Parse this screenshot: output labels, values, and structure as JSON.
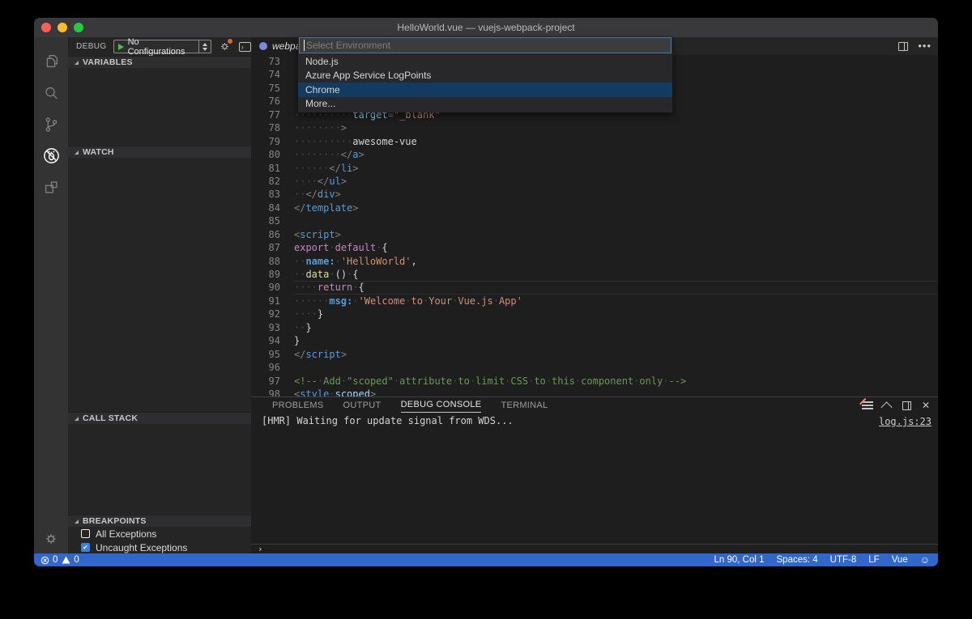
{
  "window": {
    "title": "HelloWorld.vue — vuejs-webpack-project"
  },
  "activity_bar": {
    "items": [
      {
        "icon": "explorer-icon"
      },
      {
        "icon": "search-icon"
      },
      {
        "icon": "source-control-icon"
      },
      {
        "icon": "debug-icon",
        "active": true
      },
      {
        "icon": "extensions-icon"
      }
    ],
    "settings_icon": "gear-icon"
  },
  "sidebar": {
    "toolbar": {
      "title": "DEBUG",
      "config_label": "No Configurations"
    },
    "sections": [
      {
        "title": "VARIABLES"
      },
      {
        "title": "WATCH"
      },
      {
        "title": "CALL STACK"
      },
      {
        "title": "BREAKPOINTS"
      }
    ],
    "breakpoints": [
      {
        "label": "All Exceptions",
        "checked": false
      },
      {
        "label": "Uncaught Exceptions",
        "checked": true
      }
    ]
  },
  "editor": {
    "tab": {
      "label": "webpa",
      "icon": "webpack-file-icon"
    },
    "code_lines": [
      {
        "n": "73",
        "t": []
      },
      {
        "n": "74",
        "t": []
      },
      {
        "n": "75",
        "t": []
      },
      {
        "n": "76",
        "t": []
      },
      {
        "n": "77",
        "t": [
          [
            "ws",
            "··········"
          ],
          [
            "attr",
            "target"
          ],
          [
            "punct",
            "="
          ],
          [
            "str",
            "\"_blank\""
          ]
        ]
      },
      {
        "n": "78",
        "t": [
          [
            "ws",
            "········"
          ],
          [
            "punct",
            ">"
          ]
        ]
      },
      {
        "n": "79",
        "t": [
          [
            "ws",
            "··········"
          ],
          [
            "txt",
            "awesome-vue"
          ]
        ]
      },
      {
        "n": "80",
        "t": [
          [
            "ws",
            "········"
          ],
          [
            "punct",
            "</"
          ],
          [
            "tag",
            "a"
          ],
          [
            "punct",
            ">"
          ]
        ]
      },
      {
        "n": "81",
        "t": [
          [
            "ws",
            "······"
          ],
          [
            "punct",
            "</"
          ],
          [
            "tag",
            "li"
          ],
          [
            "punct",
            ">"
          ]
        ]
      },
      {
        "n": "82",
        "t": [
          [
            "ws",
            "····"
          ],
          [
            "punct",
            "</"
          ],
          [
            "tag",
            "ul"
          ],
          [
            "punct",
            ">"
          ]
        ]
      },
      {
        "n": "83",
        "t": [
          [
            "ws",
            "··"
          ],
          [
            "punct",
            "</"
          ],
          [
            "tag",
            "div"
          ],
          [
            "punct",
            ">"
          ]
        ]
      },
      {
        "n": "84",
        "t": [
          [
            "punct",
            "</"
          ],
          [
            "tag",
            "template"
          ],
          [
            "punct",
            ">"
          ]
        ]
      },
      {
        "n": "85",
        "t": []
      },
      {
        "n": "86",
        "t": [
          [
            "punct",
            "<"
          ],
          [
            "tag",
            "script"
          ],
          [
            "punct",
            ">"
          ]
        ]
      },
      {
        "n": "87",
        "t": [
          [
            "kw",
            "export"
          ],
          [
            "ws",
            "·"
          ],
          [
            "kw",
            "default"
          ],
          [
            "ws",
            "·"
          ],
          [
            "txt",
            "{"
          ]
        ]
      },
      {
        "n": "88",
        "t": [
          [
            "ws",
            "··"
          ],
          [
            "prop",
            "name:"
          ],
          [
            "ws",
            "·"
          ],
          [
            "str",
            "'HelloWorld'"
          ],
          [
            "txt",
            ","
          ]
        ]
      },
      {
        "n": "89",
        "t": [
          [
            "ws",
            "··"
          ],
          [
            "fn",
            "data"
          ],
          [
            "ws",
            "·"
          ],
          [
            "txt",
            "()"
          ],
          [
            "ws",
            "·"
          ],
          [
            "txt",
            "{"
          ]
        ]
      },
      {
        "n": "90",
        "cur": true,
        "t": [
          [
            "ws",
            "····"
          ],
          [
            "kw",
            "return"
          ],
          [
            "ws",
            "·"
          ],
          [
            "txt",
            "{"
          ]
        ]
      },
      {
        "n": "91",
        "t": [
          [
            "ws",
            "······"
          ],
          [
            "prop",
            "msg:"
          ],
          [
            "ws",
            "·"
          ],
          [
            "str",
            "'Welcome"
          ],
          [
            "ws",
            "·"
          ],
          [
            "str",
            "to"
          ],
          [
            "ws",
            "·"
          ],
          [
            "str",
            "Your"
          ],
          [
            "ws",
            "·"
          ],
          [
            "str",
            "Vue.js"
          ],
          [
            "ws",
            "·"
          ],
          [
            "str",
            "App'"
          ]
        ]
      },
      {
        "n": "92",
        "t": [
          [
            "ws",
            "····"
          ],
          [
            "txt",
            "}"
          ]
        ]
      },
      {
        "n": "93",
        "t": [
          [
            "ws",
            "··"
          ],
          [
            "txt",
            "}"
          ]
        ]
      },
      {
        "n": "94",
        "t": [
          [
            "txt",
            "}"
          ]
        ]
      },
      {
        "n": "95",
        "t": [
          [
            "punct",
            "</"
          ],
          [
            "tag",
            "script"
          ],
          [
            "punct",
            ">"
          ]
        ]
      },
      {
        "n": "96",
        "t": []
      },
      {
        "n": "97",
        "t": [
          [
            "cmt",
            "<!--"
          ],
          [
            "ws",
            "·"
          ],
          [
            "cmt",
            "Add"
          ],
          [
            "ws",
            "·"
          ],
          [
            "cmt",
            "\"scoped\""
          ],
          [
            "ws",
            "·"
          ],
          [
            "cmt",
            "attribute"
          ],
          [
            "ws",
            "·"
          ],
          [
            "cmt",
            "to"
          ],
          [
            "ws",
            "·"
          ],
          [
            "cmt",
            "limit"
          ],
          [
            "ws",
            "·"
          ],
          [
            "cmt",
            "CSS"
          ],
          [
            "ws",
            "·"
          ],
          [
            "cmt",
            "to"
          ],
          [
            "ws",
            "·"
          ],
          [
            "cmt",
            "this"
          ],
          [
            "ws",
            "·"
          ],
          [
            "cmt",
            "component"
          ],
          [
            "ws",
            "·"
          ],
          [
            "cmt",
            "only"
          ],
          [
            "ws",
            "·"
          ],
          [
            "cmt",
            "-->"
          ]
        ]
      },
      {
        "n": "98",
        "t": [
          [
            "punct",
            "<"
          ],
          [
            "tag",
            "style"
          ],
          [
            "ws",
            "·"
          ],
          [
            "attr",
            "scoped"
          ],
          [
            "punct",
            ">"
          ]
        ]
      }
    ]
  },
  "quick_pick": {
    "placeholder": "Select Environment",
    "items": [
      {
        "label": "Node.js"
      },
      {
        "label": "Azure App Service LogPoints"
      },
      {
        "label": "Chrome",
        "selected": true
      },
      {
        "label": "More..."
      }
    ]
  },
  "panel": {
    "tabs": [
      {
        "label": "PROBLEMS"
      },
      {
        "label": "OUTPUT"
      },
      {
        "label": "DEBUG CONSOLE",
        "active": true
      },
      {
        "label": "TERMINAL"
      }
    ],
    "console_output": "[HMR] Waiting for update signal from WDS...",
    "source_link": "log.js:23",
    "prompt": "›"
  },
  "status_bar": {
    "errors": "0",
    "warnings": "0",
    "line_col": "Ln 90, Col 1",
    "indent": "Spaces: 4",
    "encoding": "UTF-8",
    "eol": "LF",
    "language": "Vue",
    "feedback_icon": "smiley-icon"
  },
  "colors": {
    "status_bar": "#3166cb",
    "list_selection": "#133a5f",
    "editor_bg": "#1e1e1e",
    "sidebar_bg": "#252526",
    "activity_bar_bg": "#333333",
    "string": "#ce9178",
    "keyword": "#c586c0",
    "tag": "#569cd6",
    "comment": "#6a9955",
    "traffic_red": "#ff5f57",
    "traffic_yellow": "#febc2e",
    "traffic_green": "#28c840"
  }
}
